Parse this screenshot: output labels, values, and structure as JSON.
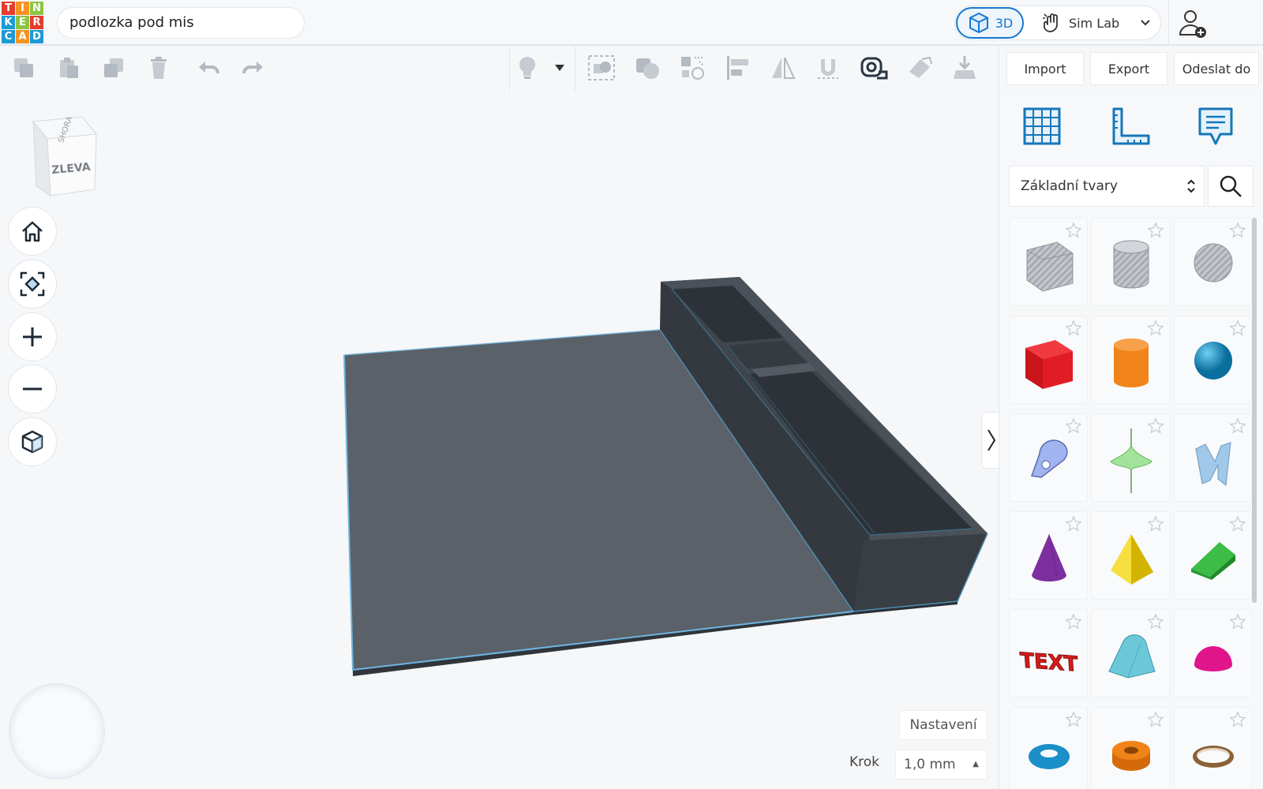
{
  "app": {
    "logo_letters": [
      "T",
      "I",
      "N",
      "K",
      "E",
      "R",
      "C",
      "A",
      "D"
    ],
    "logo_colors": [
      "#e43c2e",
      "#f79321",
      "#8cc540",
      "#1c9ad6",
      "#8cc540",
      "#e43c2e",
      "#1c9ad6",
      "#f79321",
      "#1c9ad6"
    ],
    "project_name": "podlozka pod mis",
    "accent": "#1477d1"
  },
  "topbar": {
    "view_3d_label": "3D",
    "simlab_label": "Sim Lab"
  },
  "toolbar": {
    "import_label": "Import",
    "export_label": "Export",
    "send_label": "Odeslat do"
  },
  "viewcube": {
    "front_label": "ZLEVA",
    "top_label": "SHORA"
  },
  "library": {
    "category": "Základní tvary",
    "shapes": [
      {
        "name": "box-hole",
        "color": "#b8bcc2"
      },
      {
        "name": "cylinder-hole",
        "color": "#c2c6cc"
      },
      {
        "name": "sphere-hole",
        "color": "#b4b8be"
      },
      {
        "name": "box",
        "color": "#e21c24"
      },
      {
        "name": "cylinder",
        "color": "#f08418"
      },
      {
        "name": "sphere",
        "color": "#1a9bd4"
      },
      {
        "name": "scribble",
        "color": "#a0b4f0"
      },
      {
        "name": "shape-generator",
        "color": "#a2e29a"
      },
      {
        "name": "text-shape",
        "color": "#a0c8e8"
      },
      {
        "name": "cone",
        "color": "#7e2f9f"
      },
      {
        "name": "pyramid",
        "color": "#f2d200"
      },
      {
        "name": "roof",
        "color": "#2eab3c"
      },
      {
        "name": "text",
        "color": "#d41c1c"
      },
      {
        "name": "round-roof",
        "color": "#6cc8d8"
      },
      {
        "name": "half-sphere",
        "color": "#e0158c"
      },
      {
        "name": "torus",
        "color": "#1a8fc8"
      },
      {
        "name": "tube",
        "color": "#f08418"
      },
      {
        "name": "ring",
        "color": "#8a6238"
      }
    ]
  },
  "bottom": {
    "settings_label": "Nastavení",
    "step_label": "Krok",
    "step_value": "1,0 mm"
  }
}
